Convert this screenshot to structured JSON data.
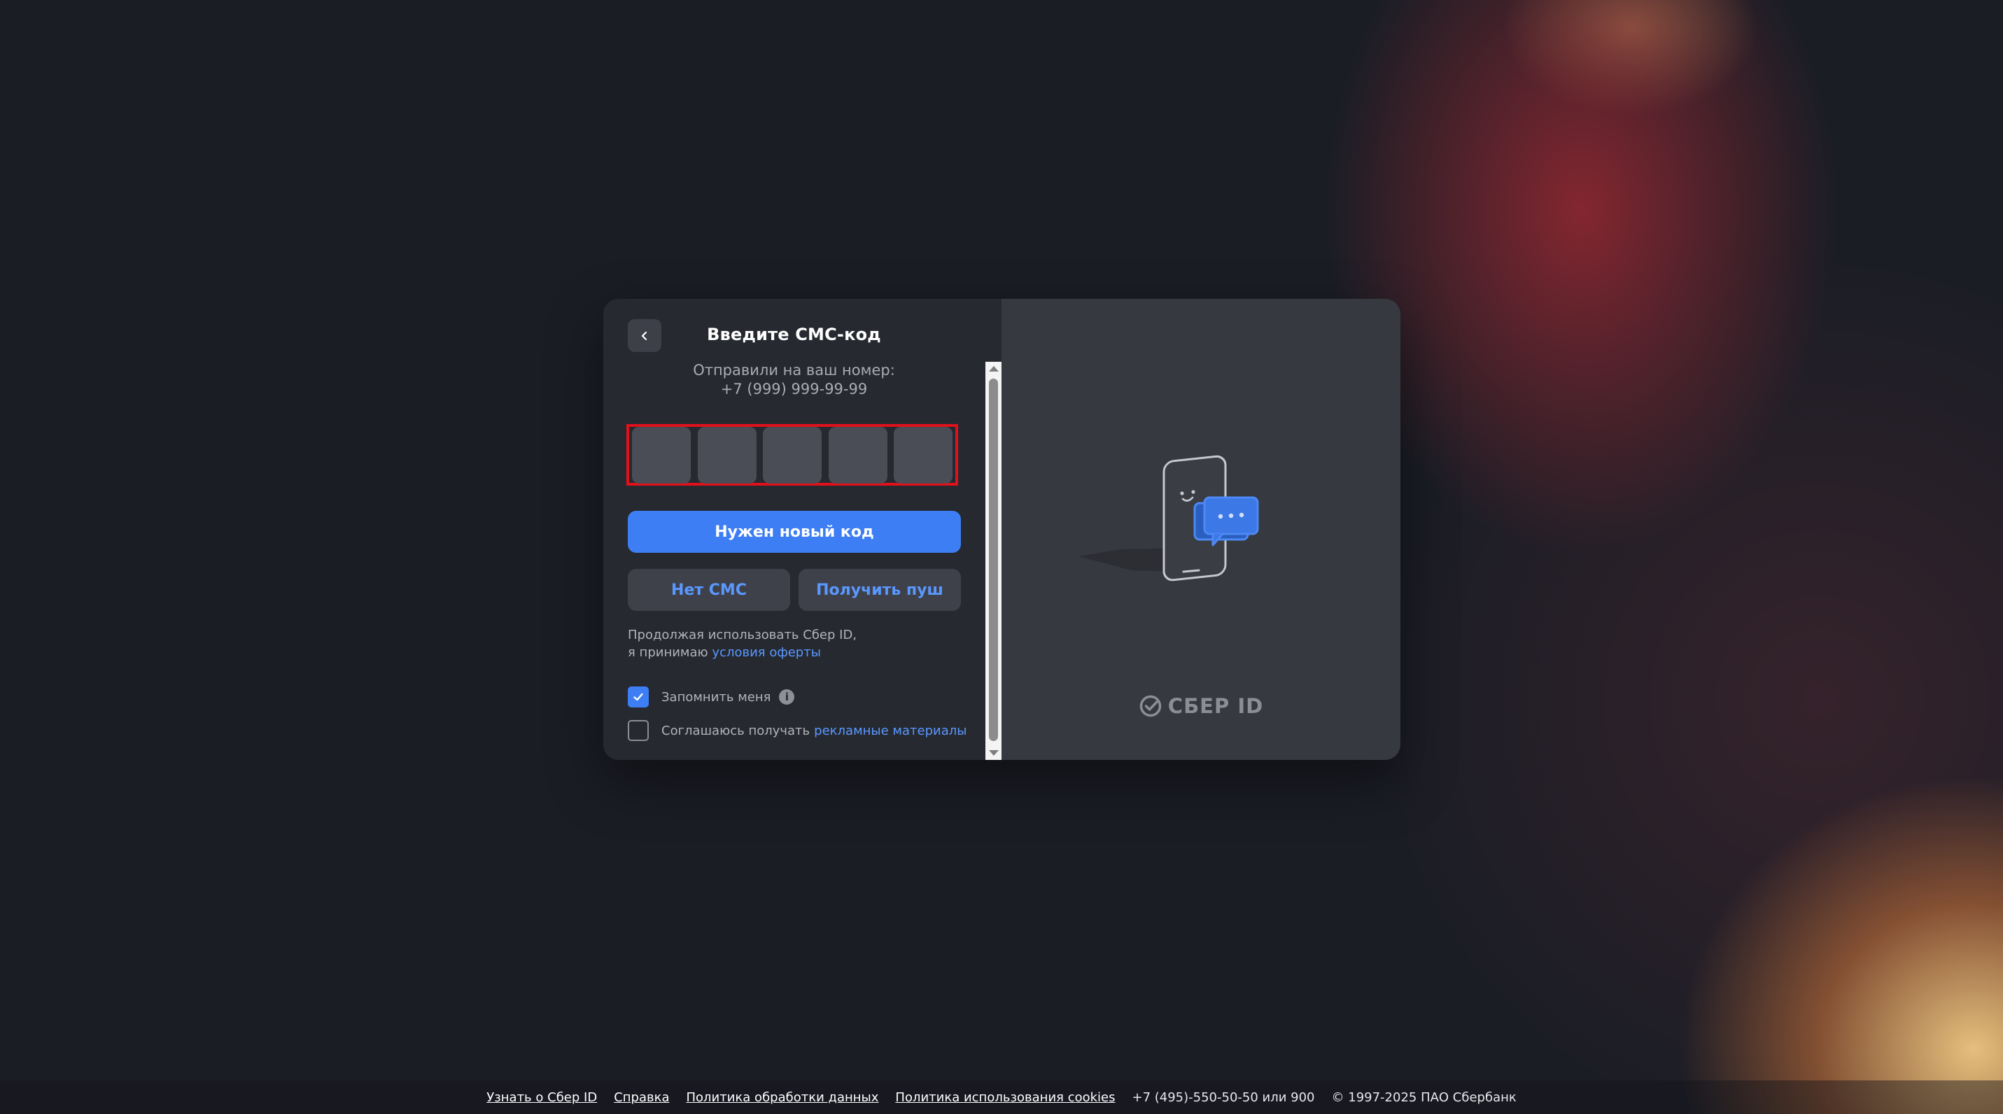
{
  "dialog": {
    "title": "Введите СМС-код",
    "sent_label": "Отправили на ваш номер:",
    "phone": "+7 (999) 999-99-99",
    "code_cells": [
      "",
      "",
      "",
      "",
      ""
    ],
    "new_code_button": "Нужен новый код",
    "no_sms_button": "Нет СМС",
    "push_button": "Получить пуш",
    "terms_line1": "Продолжая использовать Сбер ID,",
    "terms_line2_prefix": "я принимаю",
    "terms_link": "условия оферты",
    "remember_me": {
      "label": "Запомнить меня",
      "checked": true
    },
    "ads_consent": {
      "label_prefix": "Соглашаюсь получать",
      "link": "рекламные материалы",
      "checked": false
    },
    "brand": "СБЕР ID"
  },
  "footer": {
    "links": [
      "Узнать о Сбер ID",
      "Справка",
      "Политика обработки данных",
      "Политика использования cookies"
    ],
    "phone": "+7 (495)-550-50-50 или 900",
    "copyright": "© 1997-2025 ПАО Сбербанк"
  },
  "colors": {
    "accent": "#3d7ef4",
    "link": "#5a98ff",
    "highlight_border": "#e0111b"
  }
}
